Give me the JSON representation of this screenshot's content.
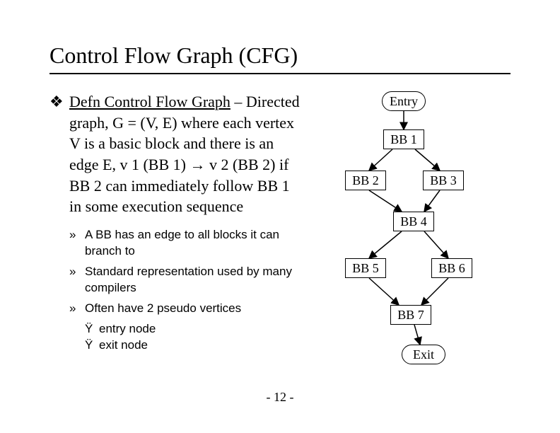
{
  "title": "Control Flow Graph (CFG)",
  "main": {
    "defn_label": "Defn Control Flow Graph",
    "defn_body": " – Directed graph, G = (V, E) where each vertex V is a basic block and there is an edge E, v 1 (BB 1) → v 2 (BB 2) if BB 2 can immediately follow BB 1 in some execution sequence"
  },
  "subs": {
    "a": "A BB has an edge to all blocks it can branch to",
    "b": "Standard representation used by many compilers",
    "c": "Often have 2 pseudo vertices",
    "c1": "entry node",
    "c2": "exit node"
  },
  "nodes": {
    "entry": "Entry",
    "bb1": "BB 1",
    "bb2": "BB 2",
    "bb3": "BB 3",
    "bb4": "BB 4",
    "bb5": "BB 5",
    "bb6": "BB 6",
    "bb7": "BB 7",
    "exit": "Exit"
  },
  "page": "- 12 -",
  "chart_data": {
    "type": "diagram",
    "title": "Control Flow Graph",
    "nodes": [
      "Entry",
      "BB1",
      "BB2",
      "BB3",
      "BB4",
      "BB5",
      "BB6",
      "BB7",
      "Exit"
    ],
    "edges": [
      [
        "Entry",
        "BB1"
      ],
      [
        "BB1",
        "BB2"
      ],
      [
        "BB1",
        "BB3"
      ],
      [
        "BB2",
        "BB4"
      ],
      [
        "BB3",
        "BB4"
      ],
      [
        "BB4",
        "BB5"
      ],
      [
        "BB4",
        "BB6"
      ],
      [
        "BB5",
        "BB7"
      ],
      [
        "BB6",
        "BB7"
      ],
      [
        "BB7",
        "Exit"
      ]
    ]
  }
}
